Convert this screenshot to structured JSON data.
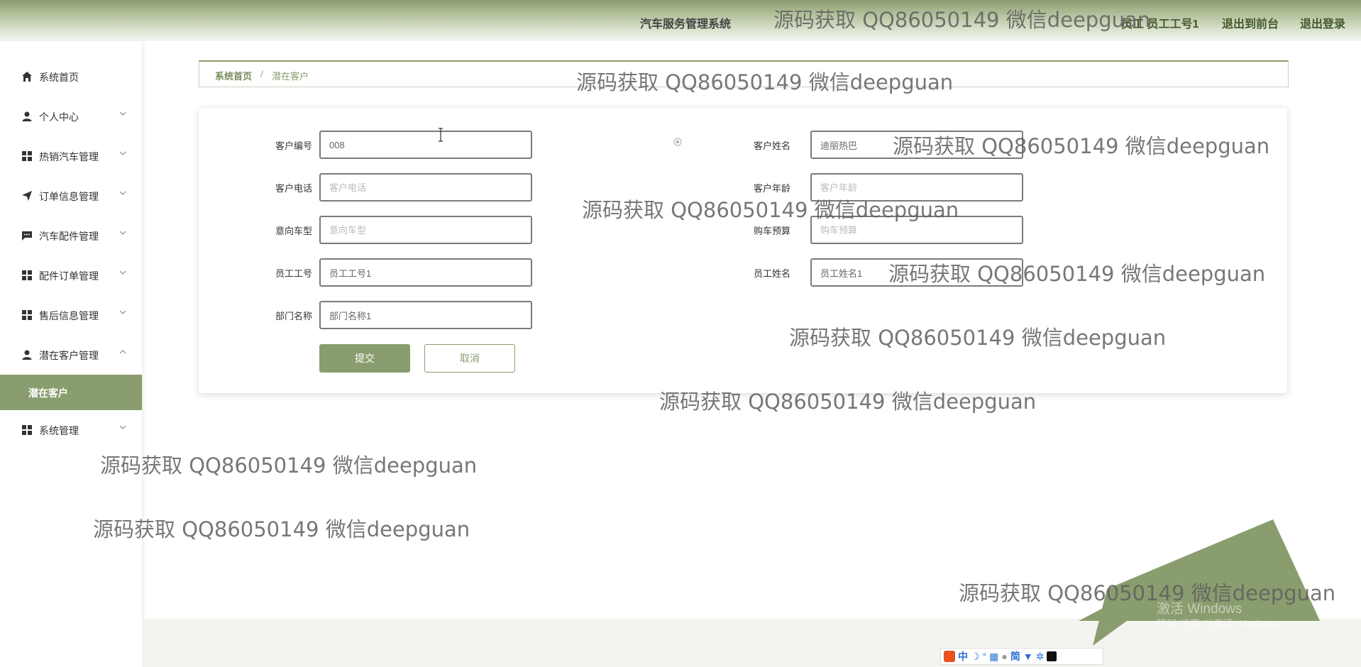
{
  "header": {
    "app_title": "汽车服务管理系统",
    "user_label": "员工 员工工号1",
    "front_link": "退出到前台",
    "logout_link": "退出登录"
  },
  "sidebar": {
    "items": [
      {
        "label": "系统首页",
        "icon": "home-icon",
        "expandable": false
      },
      {
        "label": "个人中心",
        "icon": "user-icon",
        "expandable": true
      },
      {
        "label": "热销汽车管理",
        "icon": "grid-icon",
        "expandable": true
      },
      {
        "label": "订单信息管理",
        "icon": "send-icon",
        "expandable": true
      },
      {
        "label": "汽车配件管理",
        "icon": "chat-icon",
        "expandable": true
      },
      {
        "label": "配件订单管理",
        "icon": "grid-icon",
        "expandable": true
      },
      {
        "label": "售后信息管理",
        "icon": "grid-icon",
        "expandable": true
      },
      {
        "label": "潜在客户管理",
        "icon": "user-icon",
        "expandable": true,
        "expanded": true
      },
      {
        "label": "系统管理",
        "icon": "grid-icon",
        "expandable": true
      }
    ],
    "active_subitem": "潜在客户"
  },
  "breadcrumb": {
    "home": "系统首页",
    "separator": "/",
    "current": "潜在客户"
  },
  "form": {
    "customer_no": {
      "label": "客户编号",
      "value": "008",
      "placeholder": ""
    },
    "customer_name": {
      "label": "客户姓名",
      "value": "迪丽热巴",
      "placeholder": ""
    },
    "customer_phone": {
      "label": "客户电话",
      "value": "",
      "placeholder": "客户电话"
    },
    "customer_age": {
      "label": "客户年龄",
      "value": "",
      "placeholder": "客户年龄"
    },
    "intended_model": {
      "label": "意向车型",
      "value": "",
      "placeholder": "意向车型"
    },
    "budget": {
      "label": "购车预算",
      "value": "",
      "placeholder": "购车预算"
    },
    "employee_no": {
      "label": "员工工号",
      "value": "员工工号1",
      "placeholder": ""
    },
    "employee_name": {
      "label": "员工姓名",
      "value": "员工姓名1",
      "placeholder": ""
    },
    "department": {
      "label": "部门名称",
      "value": "部门名称1",
      "placeholder": ""
    },
    "submit_label": "提交",
    "cancel_label": "取消"
  },
  "watermark": {
    "text": "源码获取 QQ86050149 微信deepguan"
  },
  "os_overlay": {
    "activate_title": "激活 Windows",
    "activate_sub": "转到\"设置\"以激活 Windows。",
    "ime_items": [
      "中",
      "简"
    ]
  },
  "colors": {
    "accent": "#8a9d6e",
    "accent_dark": "#445a2c",
    "background": "#ffffff"
  }
}
